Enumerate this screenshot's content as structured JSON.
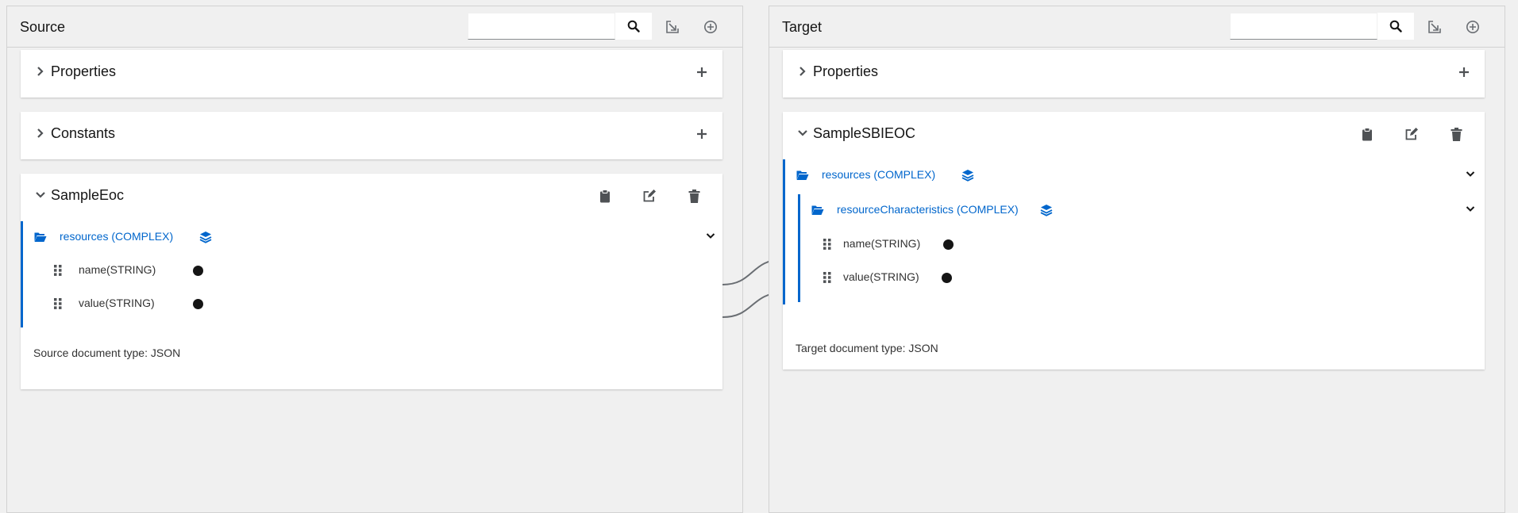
{
  "source": {
    "title": "Source",
    "search_placeholder": "",
    "sections": {
      "properties": "Properties",
      "constants": "Constants"
    },
    "document": {
      "name": "SampleEoc",
      "root_node": "resources (COMPLEX)",
      "fields": [
        "name(STRING)",
        "value(STRING)"
      ],
      "doc_type": "Source document type: JSON"
    }
  },
  "target": {
    "title": "Target",
    "search_placeholder": "",
    "sections": {
      "properties": "Properties"
    },
    "document": {
      "name": "SampleSBIEOC",
      "root_node": "resources (COMPLEX)",
      "child_node": "resourceCharacteristics (COMPLEX)",
      "fields": [
        "name(STRING)",
        "value(STRING)"
      ],
      "doc_type": "Target document type: JSON"
    }
  },
  "icons": {
    "search": "search-icon",
    "import": "import-icon",
    "add": "add-circle-icon",
    "plus": "plus-icon",
    "clipboard": "clipboard-icon",
    "edit": "edit-icon",
    "trash": "trash-icon",
    "folder": "folder-open-icon",
    "layers": "layers-icon",
    "grip": "grip-icon"
  },
  "colors": {
    "accent": "#0066cc",
    "icon": "#4f5255",
    "line": "#6a6e73"
  }
}
